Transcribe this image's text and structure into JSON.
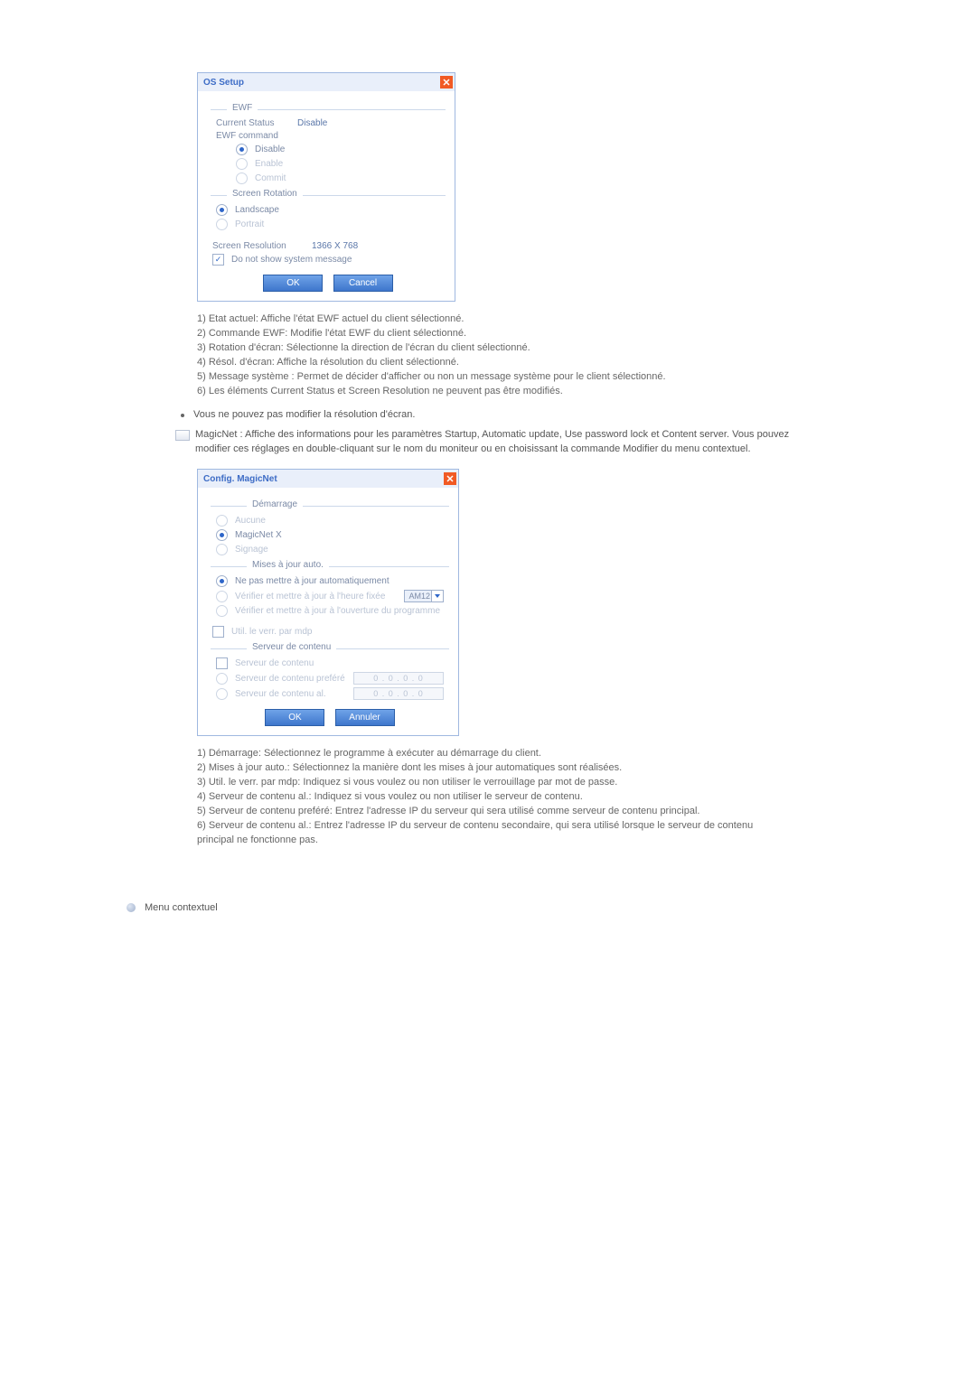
{
  "os_setup": {
    "title": "OS Setup",
    "ewf_legend": "EWF",
    "current_status_label": "Current Status",
    "current_status_value": "Disable",
    "ewf_command_label": "EWF command",
    "radio_disable": "Disable",
    "radio_enable": "Enable",
    "radio_commit": "Commit",
    "rotation_legend": "Screen Rotation",
    "radio_landscape": "Landscape",
    "radio_portrait": "Portrait",
    "res_label": "Screen Resolution",
    "res_value": "1366 X 768",
    "chk_sysmsg": "Do not show system message",
    "btn_ok": "OK",
    "btn_cancel": "Cancel"
  },
  "os_desc": {
    "l1": "1) Etat actuel: Affiche l'état EWF actuel du client sélectionné.",
    "l2": "2) Commande EWF: Modifie l'état EWF du client sélectionné.",
    "l3": "3) Rotation d'écran: Sélectionne la direction de l'écran du client sélectionné.",
    "l4": "4) Résol. d'écran: Affiche la résolution du client sélectionné.",
    "l5": "5) Message système : Permet de décider d'afficher ou non un message système pour le client sélectionné.",
    "l6": "6) Les éléments Current Status et Screen Resolution ne peuvent pas être modifiés."
  },
  "bullet": "Vous ne pouvez pas modifier la résolution d'écran.",
  "magicnet_intro": "MagicNet : Affiche des informations pour les paramètres Startup, Automatic update, Use password lock et Content server. Vous pouvez modifier ces réglages en double-cliquant sur le nom du moniteur ou en choisissant la commande Modifier du menu contextuel.",
  "magic": {
    "title": "Config. MagicNet",
    "startup_legend": "Démarrage",
    "r_aucune": "Aucune",
    "r_magicnetx": "MagicNet X",
    "r_signage": "Signage",
    "auto_legend": "Mises à jour auto.",
    "r_noauto": "Ne pas mettre à jour automatiquement",
    "r_fixed": "Vérifier et mettre à jour à l'heure fixée",
    "time_value": "AM12",
    "r_open": "Vérifier et mettre à jour à l'ouverture du programme",
    "chk_pwd": "Util. le verr. par mdp",
    "cs_legend": "Serveur de contenu",
    "chk_cs": "Serveur de contenu",
    "r_pref": "Serveur de contenu preféré",
    "r_alt": "Serveur de contenu al.",
    "ip1": "0  .  0  .  0  .  0",
    "ip2": "0  .  0  .  0  .  0",
    "btn_ok": "OK",
    "btn_cancel": "Annuler"
  },
  "magic_desc": {
    "l1": "1) Démarrage: Sélectionnez le programme à exécuter au démarrage du client.",
    "l2": "2) Mises à jour auto.: Sélectionnez la manière dont les mises à jour automatiques sont réalisées.",
    "l3": "3) Util. le verr. par mdp: Indiquez si vous voulez ou non utiliser le verrouillage par mot de passe.",
    "l4": "4) Serveur de contenu al.: Indiquez si vous voulez ou non utiliser le serveur de contenu.",
    "l5": "5) Serveur de contenu preféré: Entrez l'adresse IP du serveur qui sera utilisé comme serveur de contenu principal.",
    "l6": "6) Serveur de contenu al.: Entrez l'adresse IP du serveur de contenu secondaire, qui sera utilisé lorsque le serveur de contenu principal ne fonctionne pas."
  },
  "context_menu_heading": "Menu contextuel"
}
